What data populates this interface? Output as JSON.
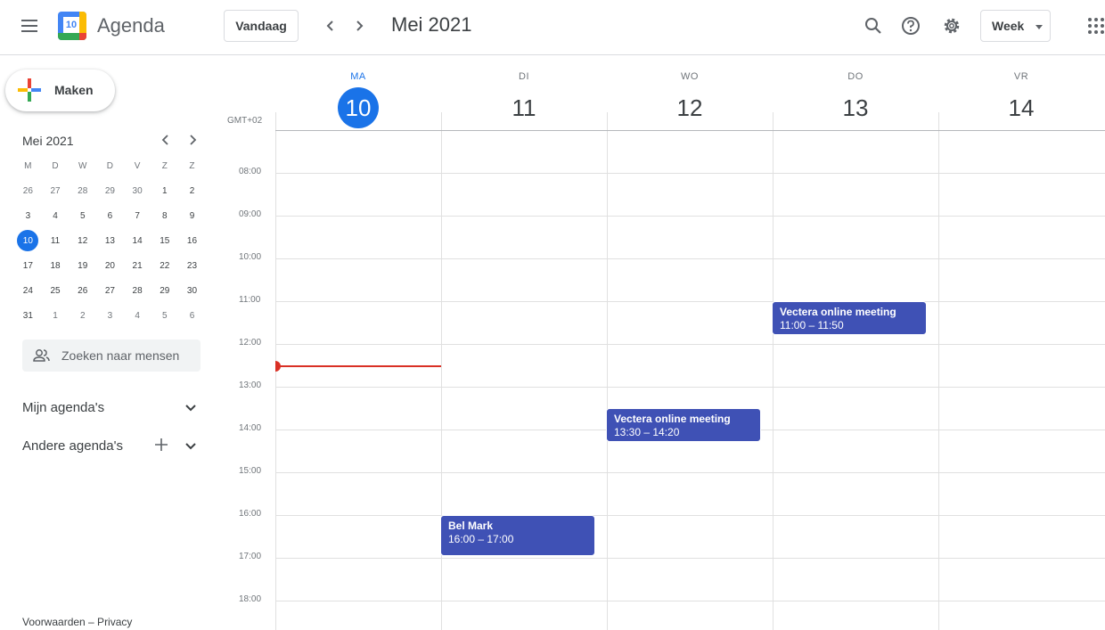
{
  "header": {
    "app_title": "Agenda",
    "logo_text": "10",
    "today_button": "Vandaag",
    "month_title": "Mei 2021",
    "view_select": "Week"
  },
  "sidebar": {
    "create_label": "Maken",
    "mini_calendar": {
      "title": "Mei 2021",
      "weekdays": [
        "M",
        "D",
        "W",
        "D",
        "V",
        "Z",
        "Z"
      ],
      "weeks": [
        [
          "26",
          "27",
          "28",
          "29",
          "30",
          "1",
          "2"
        ],
        [
          "3",
          "4",
          "5",
          "6",
          "7",
          "8",
          "9"
        ],
        [
          "10",
          "11",
          "12",
          "13",
          "14",
          "15",
          "16"
        ],
        [
          "17",
          "18",
          "19",
          "20",
          "21",
          "22",
          "23"
        ],
        [
          "24",
          "25",
          "26",
          "27",
          "28",
          "29",
          "30"
        ],
        [
          "31",
          "1",
          "2",
          "3",
          "4",
          "5",
          "6"
        ]
      ],
      "today": "10"
    },
    "search_people_placeholder": "Zoeken naar mensen",
    "my_calendars": "Mijn agenda's",
    "other_calendars": "Andere agenda's",
    "footer": "Voorwaarden – Privacy"
  },
  "week": {
    "timezone": "GMT+02",
    "days": [
      {
        "abbr": "MA",
        "num": "10",
        "current": true
      },
      {
        "abbr": "DI",
        "num": "11",
        "current": false
      },
      {
        "abbr": "WO",
        "num": "12",
        "current": false
      },
      {
        "abbr": "DO",
        "num": "13",
        "current": false
      },
      {
        "abbr": "VR",
        "num": "14",
        "current": false
      }
    ],
    "hours": [
      "08:00",
      "09:00",
      "10:00",
      "11:00",
      "12:00",
      "13:00",
      "14:00",
      "15:00",
      "16:00",
      "17:00",
      "18:00"
    ],
    "events": [
      {
        "day": 3,
        "title": "Vectera online meeting",
        "time": "11:00 – 11:50"
      },
      {
        "day": 2,
        "title": "Vectera online meeting",
        "time": "13:30 – 14:20"
      },
      {
        "day": 1,
        "title": "Bel Mark",
        "time": "16:00 – 17:00"
      }
    ]
  },
  "colors": {
    "accent": "#1a73e8",
    "event": "#3f51b5",
    "now_indicator": "#d93025"
  }
}
